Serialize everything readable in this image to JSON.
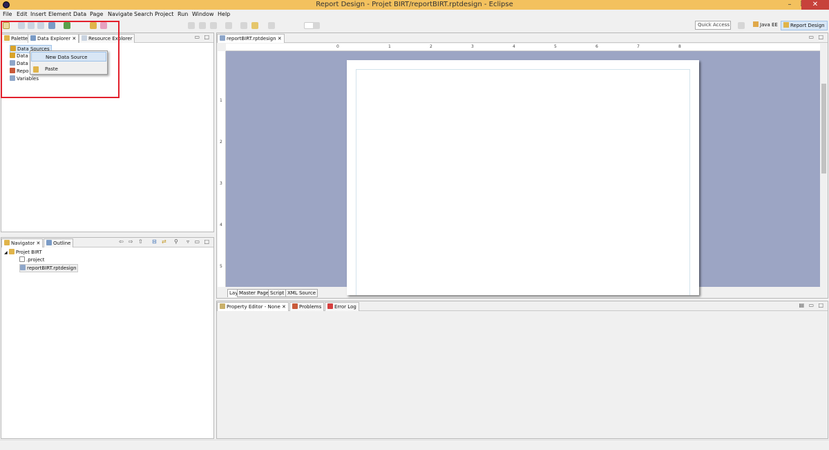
{
  "window": {
    "title": "Report Design - Projet BIRT/reportBIRT.rptdesign - Eclipse",
    "minimize": "–",
    "maximize": "❐",
    "close": "✕"
  },
  "menubar": [
    "File",
    "Edit",
    "Insert",
    "Element",
    "Data",
    "Page",
    "Navigate",
    "Search",
    "Project",
    "Run",
    "Window",
    "Help"
  ],
  "toolbar": {
    "quick_access_placeholder": "Quick Access",
    "perspective_java_ee": "Java EE",
    "perspective_report_design": "Report Design"
  },
  "data_panel": {
    "tabs": [
      "Palette",
      "Data Explorer",
      "Resource Explorer"
    ],
    "tree": [
      "Data Sources",
      "Data",
      "Data",
      "Repo",
      "Variables"
    ],
    "context_menu": [
      "New Data Source",
      "Paste"
    ]
  },
  "navigator_panel": {
    "tabs": [
      "Navigator",
      "Outline"
    ],
    "project": "Projet BIRT",
    "files": [
      ".project",
      "reportBIRT.rptdesign"
    ]
  },
  "editor": {
    "tab_title": "reportBIRT.rptdesign",
    "bottom_tabs": [
      "Layout",
      "Master Page",
      "Script",
      "XML Source"
    ],
    "ruler_h_marks": [
      "0",
      "1",
      "2",
      "3",
      "4",
      "5",
      "6",
      "7",
      "8"
    ],
    "ruler_v_marks": [
      "1",
      "2",
      "3",
      "4",
      "5"
    ]
  },
  "property_panel": {
    "tabs": [
      "Property Editor - None",
      "Problems",
      "Error Log"
    ]
  },
  "colors": {
    "titlebar": "#f3c15e",
    "close_button": "#c7423b",
    "editor_background": "#9ca5c4",
    "highlight_border": "#e2202c"
  }
}
